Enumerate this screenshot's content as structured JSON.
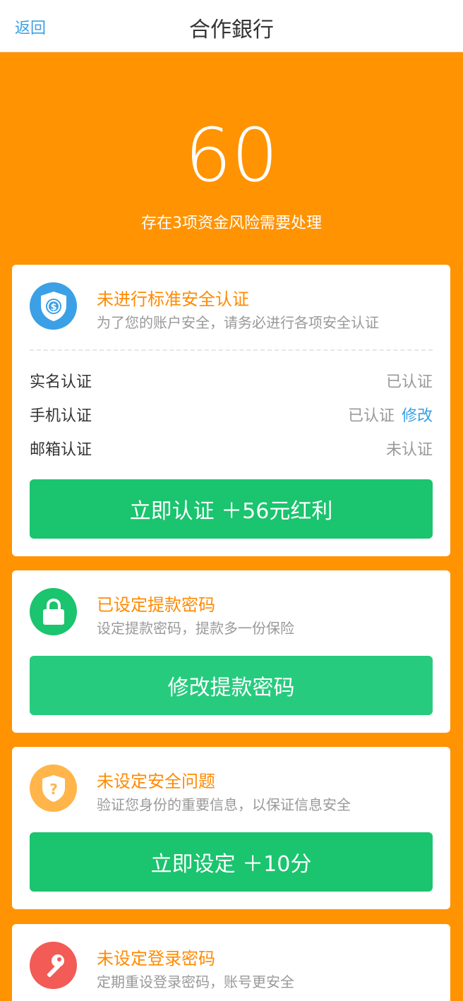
{
  "header": {
    "back_label": "返回",
    "title": "合作銀行"
  },
  "summary": {
    "score": "60",
    "subtitle": "存在3项资金风险需要处理"
  },
  "cards": [
    {
      "title": "未进行标准安全认证",
      "desc": "为了您的账户安全，请务必进行各项安全认证",
      "rows": [
        {
          "label": "实名认证",
          "status": "已认证"
        },
        {
          "label": "手机认证",
          "status": "已认证",
          "action": "修改"
        },
        {
          "label": "邮箱认证",
          "status": "未认证"
        }
      ],
      "button": "立即认证 ＋56元红利",
      "icon": "shield-dollar-icon",
      "color": "#3ba0e6"
    },
    {
      "title": "已设定提款密码",
      "desc": "设定提款密码，提款多一份保险",
      "button": "修改提款密码",
      "icon": "lock-icon",
      "color": "#1bc46e"
    },
    {
      "title": "未设定安全问题",
      "desc": "验证您身份的重要信息，以保证信息安全",
      "button": "立即设定 ＋10分",
      "icon": "shield-question-icon",
      "color": "#ffb54a"
    },
    {
      "title": "未设定登录密码",
      "desc": "定期重设登录密码，账号更安全",
      "icon": "key-icon",
      "color": "#f25b56"
    }
  ],
  "colors": {
    "background": "#ff9302",
    "accent_green": "#1bc46e",
    "link_blue": "#3ba0e6",
    "title_orange": "#ff8a00"
  }
}
